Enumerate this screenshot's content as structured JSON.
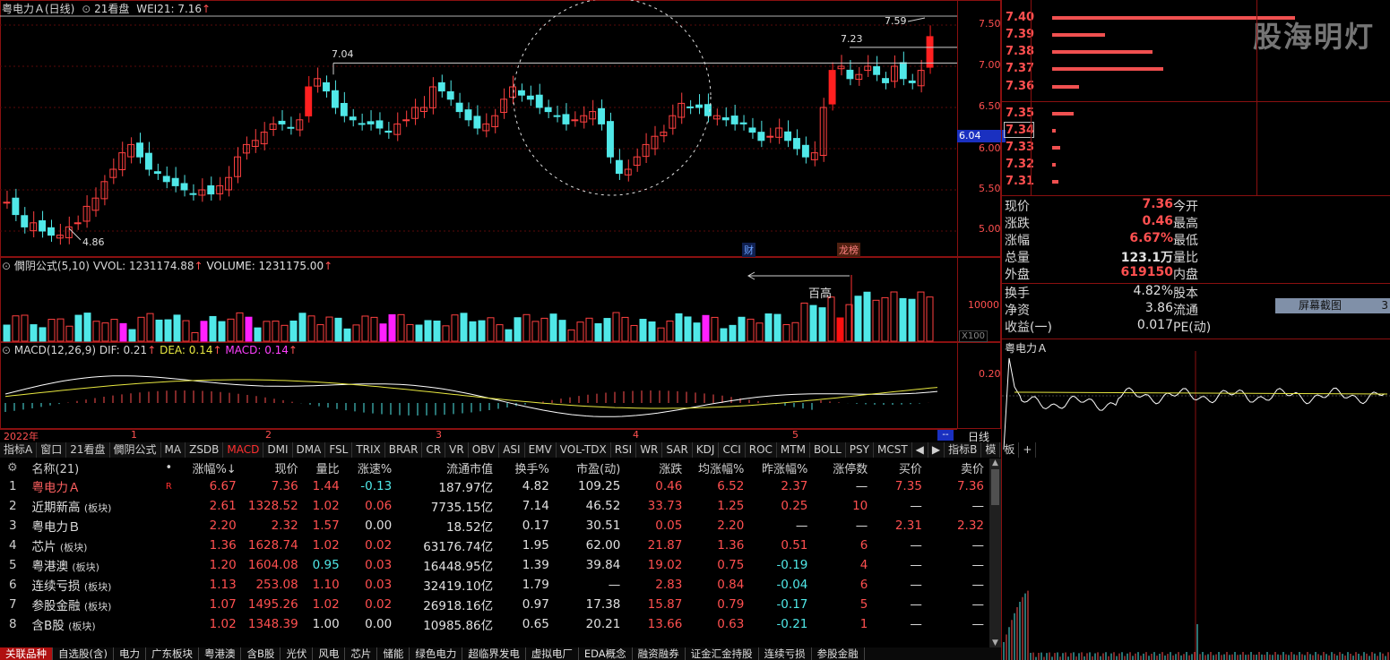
{
  "header": {
    "stock": "粤电力Ａ(日线)",
    "indicator": "21看盘",
    "wei_label": "WEI21: 7.16",
    "up_arrow": "↑"
  },
  "kline": {
    "price_axis": [
      "7.50",
      "7.00",
      "6.50",
      "6.00",
      "5.50",
      "5.00"
    ],
    "current_price_tag": "6.04",
    "annotations": {
      "high_759": "7.59",
      "high_723": "7.23",
      "high_704": "7.04",
      "low_486": "4.86",
      "cai": "财",
      "longhu": "龙榜"
    },
    "watermark": "股海明灯"
  },
  "volume_pane": {
    "title": "僩阴公式(5,10)",
    "vvol": "VVOL: 1231174.88",
    "volume": "VOLUME: 1231175.00",
    "axis": "10000",
    "unit": "X100",
    "note": "百高",
    "marks": [
      "3",
      "3",
      "3",
      "1",
      "3",
      "3",
      "2",
      "3",
      "3",
      "3",
      "3",
      "2",
      "3",
      "3",
      "3",
      "3"
    ]
  },
  "macd_pane": {
    "title": "MACD(12,26,9)",
    "dif": "DIF: 0.21",
    "dea": "DEA: 0.14",
    "macd": "MACD: 0.14",
    "axis": "0.20"
  },
  "timeaxis": {
    "year": "2022年",
    "months": [
      "1",
      "2",
      "3",
      "4",
      "5"
    ],
    "period": "日线",
    "dashes": "--"
  },
  "tabs": [
    "指标A",
    "窗口",
    "21看盘",
    "僩阴公式",
    "MA",
    "ZSDB",
    "MACD",
    "DMI",
    "DMA",
    "FSL",
    "TRIX",
    "BRAR",
    "CR",
    "VR",
    "OBV",
    "ASI",
    "EMV",
    "VOL-TDX",
    "RSI",
    "WR",
    "SAR",
    "KDJ",
    "CCI",
    "ROC",
    "MTM",
    "BOLL",
    "PSY",
    "MCST",
    "◀",
    "▶",
    "指标B",
    "模",
    "板",
    "+"
  ],
  "table": {
    "headers": [
      "名称(21)",
      "•",
      "涨幅%↓",
      "现价",
      "量比",
      "涨速%",
      "流通市值",
      "换手%",
      "市盈(动)",
      "涨跌",
      "均涨幅%",
      "昨涨幅%",
      "涨停数",
      "买价",
      "卖价"
    ],
    "rows": [
      {
        "idx": "1",
        "name": "粤电力Ａ",
        "tag": "",
        "flag": "R",
        "zf": "6.67",
        "xj": "7.36",
        "lb": "1.44",
        "zs": "-0.13",
        "ltsz": "187.97亿",
        "hs": "4.82",
        "syl": "109.25",
        "zd": "0.46",
        "jzf": "6.52",
        "zzf": "2.37",
        "zts": "—",
        "mj": "7.35",
        "mjj": "7.36"
      },
      {
        "idx": "2",
        "name": "近期新高",
        "tag": "(板块)",
        "flag": "",
        "zf": "2.61",
        "xj": "1328.52",
        "lb": "1.02",
        "zs": "0.06",
        "ltsz": "7735.15亿",
        "hs": "7.14",
        "syl": "46.52",
        "zd": "33.73",
        "jzf": "1.25",
        "zzf": "0.25",
        "zts": "10",
        "mj": "—",
        "mjj": "—"
      },
      {
        "idx": "3",
        "name": "粤电力Ｂ",
        "tag": "",
        "flag": "",
        "zf": "2.20",
        "xj": "2.32",
        "lb": "1.57",
        "zs": "0.00",
        "ltsz": "18.52亿",
        "hs": "0.17",
        "syl": "30.51",
        "zd": "0.05",
        "jzf": "2.20",
        "zzf": "—",
        "zts": "—",
        "mj": "2.31",
        "mjj": "2.32"
      },
      {
        "idx": "4",
        "name": "芯片",
        "tag": "(板块)",
        "flag": "",
        "zf": "1.36",
        "xj": "1628.74",
        "lb": "1.02",
        "zs": "0.02",
        "ltsz": "63176.74亿",
        "hs": "1.95",
        "syl": "62.00",
        "zd": "21.87",
        "jzf": "1.36",
        "zzf": "0.51",
        "zts": "6",
        "mj": "—",
        "mjj": "—"
      },
      {
        "idx": "5",
        "name": "粤港澳",
        "tag": "(板块)",
        "flag": "",
        "zf": "1.20",
        "xj": "1604.08",
        "lb": "0.95",
        "zs": "0.03",
        "ltsz": "16448.95亿",
        "hs": "1.39",
        "syl": "39.84",
        "zd": "19.02",
        "jzf": "0.75",
        "zzf": "-0.19",
        "zts": "4",
        "mj": "—",
        "mjj": "—"
      },
      {
        "idx": "6",
        "name": "连续亏损",
        "tag": "(板块)",
        "flag": "",
        "zf": "1.13",
        "xj": "253.08",
        "lb": "1.10",
        "zs": "0.03",
        "ltsz": "32419.10亿",
        "hs": "1.79",
        "syl": "—",
        "zd": "2.83",
        "jzf": "0.84",
        "zzf": "-0.04",
        "zts": "6",
        "mj": "—",
        "mjj": "—"
      },
      {
        "idx": "7",
        "name": "参股金融",
        "tag": "(板块)",
        "flag": "",
        "zf": "1.07",
        "xj": "1495.26",
        "lb": "1.02",
        "zs": "0.02",
        "ltsz": "26918.16亿",
        "hs": "0.97",
        "syl": "17.38",
        "zd": "15.87",
        "jzf": "0.79",
        "zzf": "-0.17",
        "zts": "5",
        "mj": "—",
        "mjj": "—"
      },
      {
        "idx": "8",
        "name": "含B股",
        "tag": "(板块)",
        "flag": "",
        "zf": "1.02",
        "xj": "1348.39",
        "lb": "1.00",
        "zs": "0.00",
        "ltsz": "10985.86亿",
        "hs": "0.65",
        "syl": "20.21",
        "zd": "13.66",
        "jzf": "0.63",
        "zzf": "-0.21",
        "zts": "1",
        "mj": "—",
        "mjj": "—"
      }
    ]
  },
  "bottom_tabs": [
    "关联品种",
    "自选股(含)",
    "电力",
    "广东板块",
    "粤港澳",
    "含B股",
    "光伏",
    "风电",
    "芯片",
    "储能",
    "绿色电力",
    "超临界发电",
    "虚拟电厂",
    "EDA概念",
    "融资融券",
    "证金汇金持股",
    "连续亏损",
    "参股金融"
  ],
  "orderbook": [
    {
      "price": "7.40",
      "bar": 0.92
    },
    {
      "price": "7.39",
      "bar": 0.2
    },
    {
      "price": "7.38",
      "bar": 0.38
    },
    {
      "price": "7.37",
      "bar": 0.42
    },
    {
      "price": "7.36",
      "bar": 0.1
    },
    {
      "price": "7.35",
      "bar": 0.08
    },
    {
      "price": "7.34",
      "bar": 0.015
    },
    {
      "price": "7.33",
      "bar": 0.03
    },
    {
      "price": "7.32",
      "bar": 0.012
    },
    {
      "price": "7.31",
      "bar": 0.025
    }
  ],
  "quote": [
    {
      "k": "现价",
      "v": "7.36",
      "k2": "今开"
    },
    {
      "k": "涨跌",
      "v": "0.46",
      "k2": "最高"
    },
    {
      "k": "涨幅",
      "v": "6.67%",
      "k2": "最低"
    },
    {
      "k": "总量",
      "v": "123.1万",
      "k2": "量比"
    },
    {
      "k": "外盘",
      "v": "619150",
      "k2": "内盘"
    },
    {
      "k": "换手",
      "v": "4.82%",
      "k2": "股本"
    },
    {
      "k": "净资",
      "v": "3.86",
      "k2": "流通"
    },
    {
      "k": "收益(一)",
      "v": "0.017",
      "k2": "PE(动)"
    }
  ],
  "screenshot_btn": "屏幕截图",
  "screenshot_num": "3",
  "intraday_title": "粤电力Ａ",
  "colors": {
    "up": "#ff3030",
    "down": "#50e8e8",
    "bg": "#000000",
    "border": "#8a1010"
  }
}
